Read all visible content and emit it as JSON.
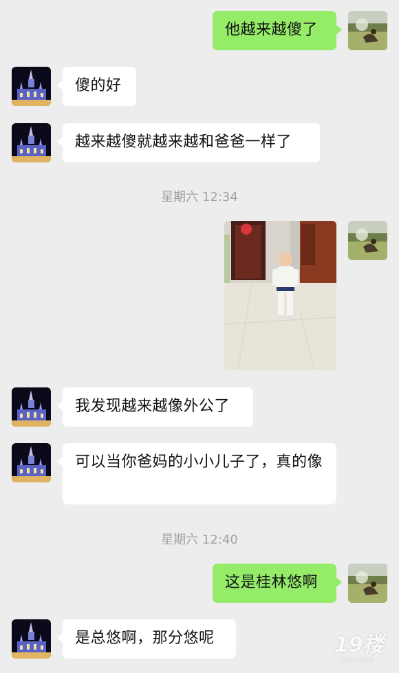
{
  "messages": [
    {
      "side": "right",
      "text": "他越来越傻了",
      "avatar": "woman-on-grass-avatar"
    },
    {
      "side": "left",
      "text": "傻的好",
      "avatar": "castle-avatar"
    },
    {
      "side": "left",
      "text": "越来越傻就越来越和爸爸一样了",
      "avatar": "castle-avatar"
    },
    {
      "type": "timestamp",
      "text": "星期六 12:34"
    },
    {
      "side": "right",
      "type": "image",
      "avatar": "woman-on-grass-avatar",
      "image": "toddler-photo"
    },
    {
      "side": "left",
      "text": "我发现越来越像外公了",
      "avatar": "castle-avatar"
    },
    {
      "side": "left",
      "text": "可以当你爸妈的小小儿子了，真的像",
      "avatar": "castle-avatar"
    },
    {
      "type": "timestamp",
      "text": "星期六 12:40"
    },
    {
      "side": "right",
      "text": "这是桂林悠啊",
      "avatar": "woman-on-grass-avatar"
    },
    {
      "side": "left",
      "text": "是总悠啊，那分悠呢",
      "avatar": "castle-avatar"
    }
  ],
  "watermark": {
    "main": "19楼",
    "sub": "19lou.com"
  },
  "colors": {
    "background": "#ededed",
    "bubble_right": "#95ec69",
    "bubble_left": "#ffffff",
    "timestamp_text": "#a2a2a2"
  }
}
